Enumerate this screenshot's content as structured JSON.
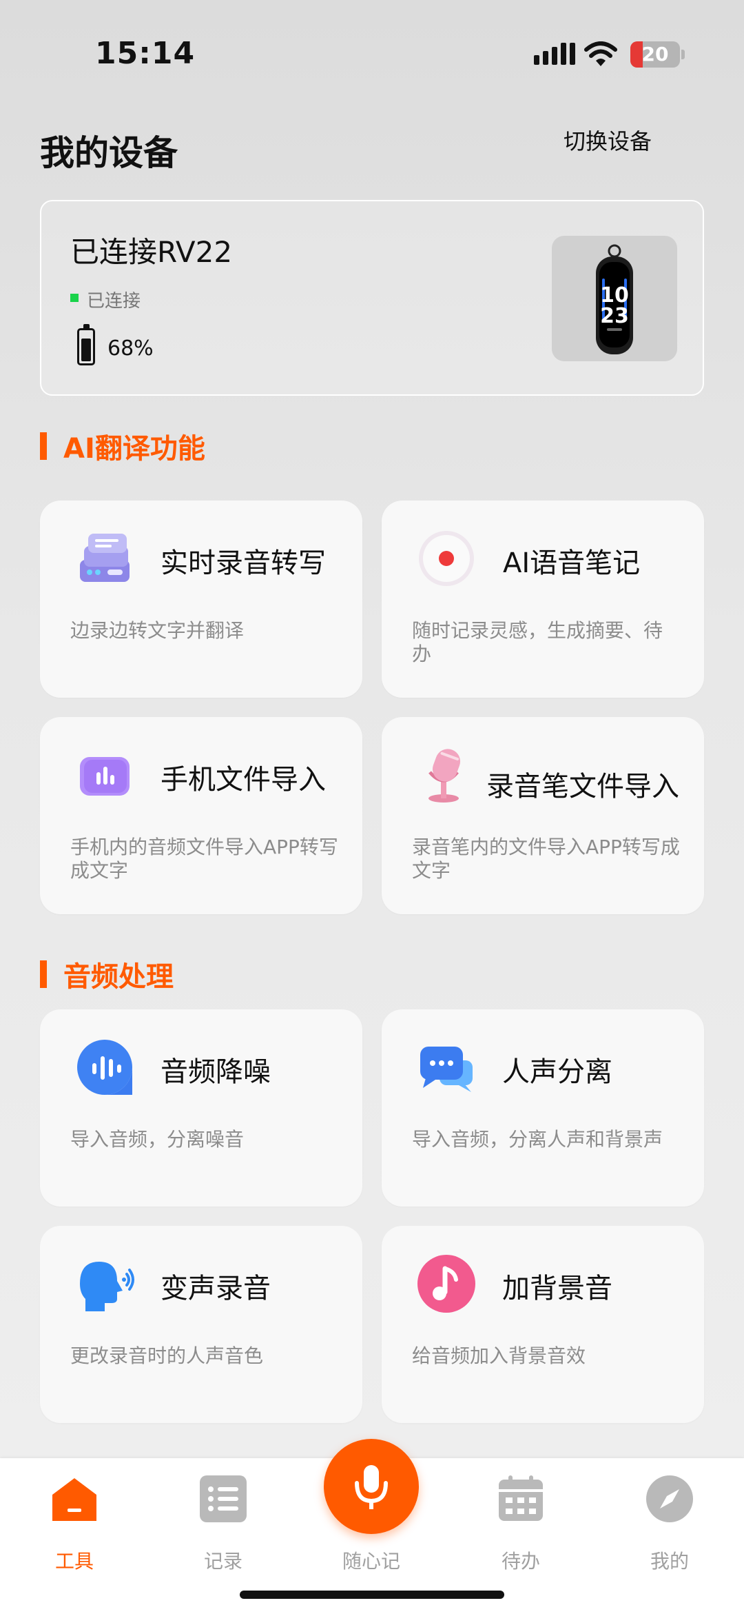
{
  "status_bar": {
    "time": "15:14",
    "battery": "20"
  },
  "header": {
    "title": "我的设备",
    "switch_label": "切换设备"
  },
  "device": {
    "name": "已连接RV22",
    "status": "已连接",
    "battery": "68%",
    "screen_top": "10",
    "screen_bottom": "23"
  },
  "sections": [
    {
      "title": "AI翻译功能",
      "cards": [
        {
          "title": "实时录音转写",
          "desc": "边录边转文字并翻译",
          "icon": "server-stack-icon"
        },
        {
          "title": "AI语音笔记",
          "desc": "随时记录灵感，生成摘要、待办",
          "icon": "record-dot-icon"
        },
        {
          "title": "手机文件导入",
          "desc": "手机内的音频文件导入APP转写成文字",
          "icon": "audio-bars-icon"
        },
        {
          "title": "录音笔文件导入",
          "desc": "录音笔内的文件导入APP转写成文字",
          "icon": "microphone-stand-icon"
        }
      ]
    },
    {
      "title": "音频处理",
      "cards": [
        {
          "title": "音频降噪",
          "desc": "导入音频，分离噪音",
          "icon": "waveform-bubble-icon"
        },
        {
          "title": "人声分离",
          "desc": "导入音频，分离人声和背景声",
          "icon": "chat-bubbles-icon"
        },
        {
          "title": "变声录音",
          "desc": "更改录音时的人声音色",
          "icon": "speaking-head-icon"
        },
        {
          "title": "加背景音",
          "desc": "给音频加入背景音效",
          "icon": "music-note-icon"
        }
      ]
    }
  ],
  "tabs": [
    {
      "label": "工具",
      "icon": "home-icon",
      "active": true
    },
    {
      "label": "记录",
      "icon": "list-icon",
      "active": false
    },
    {
      "label": "随心记",
      "icon": "microphone-icon",
      "active": false
    },
    {
      "label": "待办",
      "icon": "calendar-icon",
      "active": false
    },
    {
      "label": "我的",
      "icon": "compass-icon",
      "active": false
    }
  ],
  "colors": {
    "accent": "#ff5a00",
    "connected": "#19d34a"
  }
}
